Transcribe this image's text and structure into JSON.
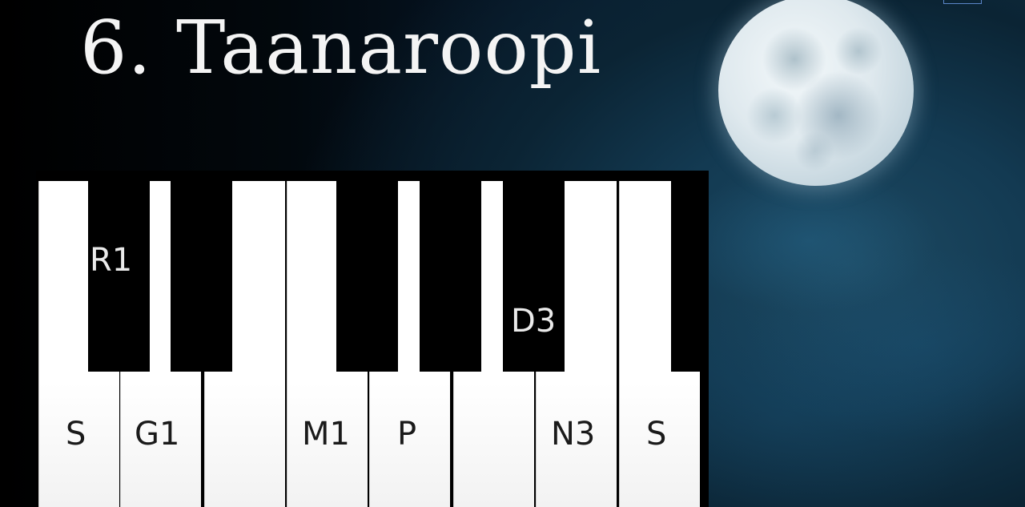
{
  "title": "6. Taanaroopi",
  "keyboard": {
    "white_labels": [
      "S",
      "G1",
      "M1",
      "P",
      "N3",
      "S"
    ],
    "black_labels": [
      "R1",
      "D3"
    ]
  }
}
